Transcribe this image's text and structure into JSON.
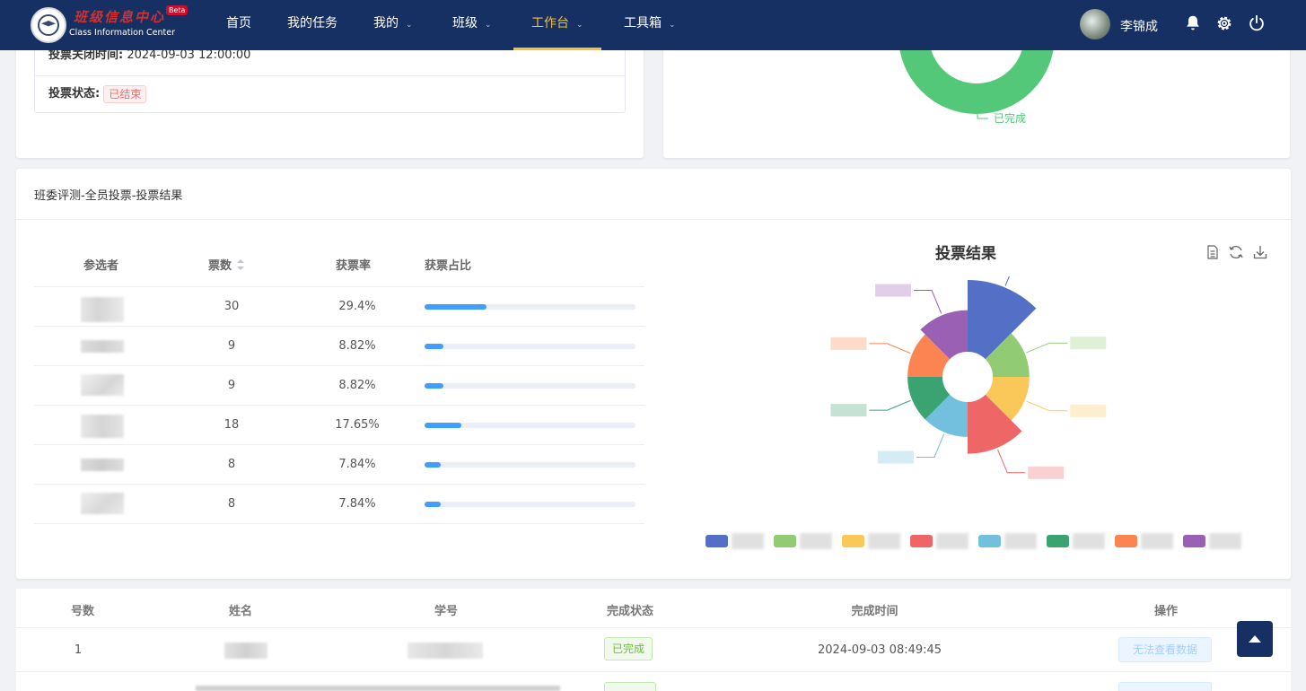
{
  "nav": {
    "brand_cn": "班级信息中心",
    "brand_badge": "Beta",
    "brand_en": "Class Information Center",
    "menu": [
      {
        "label": "首页",
        "dropdown": false,
        "active": false
      },
      {
        "label": "我的任务",
        "dropdown": false,
        "active": false
      },
      {
        "label": "我的",
        "dropdown": true,
        "active": false
      },
      {
        "label": "班级",
        "dropdown": true,
        "active": false
      },
      {
        "label": "工作台",
        "dropdown": true,
        "active": true
      },
      {
        "label": "工具箱",
        "dropdown": true,
        "active": false
      }
    ],
    "username": "李锦成",
    "icons": [
      "bell-icon",
      "gear-icon",
      "power-icon"
    ],
    "colors": {
      "bg": "#173064",
      "active": "#f1c232"
    }
  },
  "vote_info": {
    "close_time_label": "投票关闭时间:",
    "close_time_value": "2024-09-03 12:00:00",
    "status_label": "投票状态:",
    "status_value": "已结束"
  },
  "completion_chart": {
    "label": "已完成",
    "color": "#52c878"
  },
  "result_section": {
    "title": "班委评测-全员投票-投票结果",
    "columns": [
      "参选者",
      "票数",
      "获票率",
      "获票占比"
    ],
    "rows": [
      {
        "votes": "30",
        "rate": "29.4%",
        "ratio": 0.294
      },
      {
        "votes": "9",
        "rate": "8.82%",
        "ratio": 0.0882
      },
      {
        "votes": "9",
        "rate": "8.82%",
        "ratio": 0.0882
      },
      {
        "votes": "18",
        "rate": "17.65%",
        "ratio": 0.1765
      },
      {
        "votes": "8",
        "rate": "7.84%",
        "ratio": 0.0784
      },
      {
        "votes": "8",
        "rate": "7.84%",
        "ratio": 0.0784
      }
    ]
  },
  "chart_data": {
    "type": "pie",
    "title": "投票结果",
    "variant": "rose",
    "values": [
      30,
      9,
      9,
      18,
      8,
      8,
      8,
      12
    ],
    "colors": [
      "#5470c6",
      "#91cc75",
      "#fac858",
      "#ee6666",
      "#73c0de",
      "#3ba272",
      "#fc8452",
      "#9a60b4"
    ],
    "legend_position": "bottom",
    "toolbox": [
      "data-view-icon",
      "refresh-icon",
      "download-icon"
    ]
  },
  "members_table": {
    "columns": [
      "号数",
      "姓名",
      "学号",
      "完成状态",
      "完成时间",
      "操作"
    ],
    "rows": [
      {
        "no": "1",
        "status": "已完成",
        "time": "2024-09-03 08:49:45",
        "action": "无法查看数据"
      }
    ]
  }
}
